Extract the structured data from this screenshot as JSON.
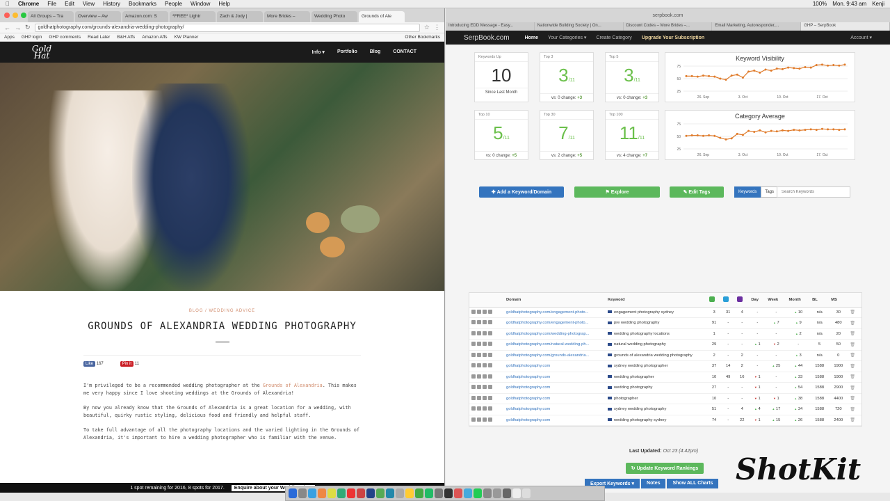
{
  "menubar": {
    "app": "Chrome",
    "items": [
      "File",
      "Edit",
      "View",
      "History",
      "Bookmarks",
      "People",
      "Window",
      "Help"
    ],
    "battery": "100%",
    "clock": "Mon. 9:43 am",
    "user": "Kenji"
  },
  "left": {
    "tabs": [
      "All Groups – Tra",
      "Overview – Aw",
      "Amazon.com: S",
      "*FREE* Lightr",
      "Zach & Jody |",
      "More Brides –",
      "Wedding Photo",
      "Grounds of Ale"
    ],
    "url": "goldhatphotography.com/grounds-alexandria-wedding-photography/",
    "bookmarks": [
      "Apps",
      "GHP login",
      "GHP comments",
      "Read Later",
      "B&H Affs",
      "Amazon Affs",
      "KW Planner",
      "Other Bookmarks"
    ],
    "site": {
      "logo": "Gold Hat",
      "nav": [
        "Info ▾",
        "Portfolio",
        "Blog",
        "CONTACT"
      ]
    },
    "crumbs": "BLOG  /  WEDDING ADVICE",
    "title": "GROUNDS OF ALEXANDRIA WEDDING PHOTOGRAPHY",
    "social": {
      "like": "Like",
      "likes": "167",
      "pin": "Pin it",
      "pins": "11"
    },
    "paragraphs": [
      {
        "pre": "I'm privileged to be a recommended wedding photographer at the ",
        "link": "Grounds of Alexandria",
        "post": ". This makes me very happy since I love shooting weddings at the Grounds of Alexandria!"
      },
      {
        "pre": "By now you already know that the Grounds of Alexandria is a great location for a wedding, with beautiful, quirky rustic styling, delicious food and friendly and helpful staff.",
        "link": "",
        "post": ""
      },
      {
        "pre": "To take full advantage of all the photography locations and the varied lighting in the Grounds of Alexandria, it's important to hire a wedding photographer who is familiar with the venue.",
        "link": "",
        "post": ""
      }
    ],
    "banner": {
      "text": "1 spot remaining for 2016, 8 spots for 2017.",
      "cta": "Enquire about your Wedding date"
    }
  },
  "right": {
    "toolbar_url": "serpbook.com",
    "tabs": [
      "Introducing EDD Message - Easy...",
      "Nationwide Building Society | On...",
      "Discount Codes – More Brides –...",
      "Email Marketing, Autoresponder,...",
      "GHP – SerpBook"
    ],
    "nav": {
      "brand": "SerpBook.com",
      "home": "Home",
      "categories": "Your Categories ▾",
      "create": "Create Category",
      "upgrade": "Upgrade Your Subscription",
      "account": "Account ▾"
    },
    "cards": [
      {
        "label": "Keywords Up",
        "value": "10",
        "sub": "Since Last Month",
        "green": false
      },
      {
        "label": "Top 3",
        "value": "3",
        "of": "/11",
        "sub": "vs: 0 change:",
        "change": "+3",
        "green": true
      },
      {
        "label": "Top 5",
        "value": "3",
        "of": "/11",
        "sub": "vs: 0 change:",
        "change": "+3",
        "green": true
      },
      {
        "label": "Top 10",
        "value": "5",
        "of": "/11",
        "sub": "vs: 0 change:",
        "change": "+5",
        "green": true
      },
      {
        "label": "Top 30",
        "value": "7",
        "of": "/11",
        "sub": "vs: 2 change:",
        "change": "+5",
        "green": true
      },
      {
        "label": "Top 100",
        "value": "11",
        "of": "/11",
        "sub": "vs: 4 change:",
        "change": "+7",
        "green": true
      }
    ],
    "charts": [
      {
        "title": "Keyword Visibility",
        "yticks": [
          "75",
          "50",
          "25"
        ],
        "xticks": [
          "26. Sep",
          "3. Oct",
          "10. Oct",
          "17. Oct"
        ],
        "color": "#e07b2a",
        "values": [
          55,
          55,
          54,
          56,
          55,
          54,
          50,
          48,
          56,
          58,
          52,
          64,
          66,
          62,
          68,
          66,
          70,
          69,
          72,
          71,
          70,
          73,
          72,
          77,
          78,
          76,
          77,
          76,
          78
        ]
      },
      {
        "title": "Category Average",
        "yticks": [
          "75",
          "50",
          "25"
        ],
        "xticks": [
          "26. Sep",
          "3. Oct",
          "10. Oct",
          "17. Oct"
        ],
        "color": "#e07b2a",
        "values": [
          51,
          52,
          52,
          51,
          52,
          51,
          47,
          44,
          46,
          55,
          53,
          61,
          59,
          62,
          58,
          61,
          60,
          62,
          61,
          63,
          62,
          63,
          64,
          63,
          65,
          64,
          64,
          63,
          64
        ]
      }
    ],
    "buttons": {
      "add": "Add a Keyword/Domain",
      "explore": "Explore",
      "edit": "Edit Tags",
      "seg": [
        "Keywords",
        "Tags"
      ],
      "search_placeholder": "Search Keywords"
    },
    "table": {
      "headers": [
        "",
        "Domain",
        "Keyword",
        "",
        "",
        "",
        "Day",
        "Week",
        "Month",
        "BL",
        "MS",
        ""
      ],
      "rows": [
        {
          "domain": "goldhatphotography.com/engagement-photo...",
          "keyword": "engagement photography sydney",
          "g": "3",
          "b": "31",
          "y": "4",
          "day": "-",
          "week": "-",
          "month": "10",
          "mdir": "up",
          "bl": "n/a",
          "ms": "30"
        },
        {
          "domain": "goldhatphotography.com/engagement-photo...",
          "keyword": "pre wedding photography",
          "g": "91",
          "b": "-",
          "y": "-",
          "day": "-",
          "dday": "",
          "week": "7",
          "wdir": "up",
          "wk2": "9",
          "w2dir": "up",
          "month": "9",
          "mdir": "up",
          "bl": "n/a",
          "ms": "480"
        },
        {
          "domain": "goldhatphotography.com/wedding-photograp...",
          "keyword": "wedding photography locations",
          "g": "1",
          "b": "-",
          "y": "-",
          "day": "-",
          "week": "-",
          "month": "2",
          "mdir": "up",
          "bl": "n/a",
          "ms": "20"
        },
        {
          "domain": "goldhatphotography.com/natural-wedding-ph...",
          "keyword": "natural wedding photography",
          "g": "29",
          "b": "-",
          "y": "-",
          "day": "1",
          "ddir": "up",
          "week": "2",
          "wdir": "dn",
          "month": "-",
          "bl": "5",
          "ms": "50"
        },
        {
          "domain": "goldhatphotography.com/grounds-alexandria...",
          "keyword": "grounds of alexandria wedding photography",
          "g": "2",
          "b": "-",
          "y": "2",
          "day": "-",
          "week": "-",
          "month": "3",
          "mdir": "up",
          "bl": "n/a",
          "ms": "0"
        },
        {
          "domain": "goldhatphotography.com",
          "keyword": "sydney wedding photographer",
          "g": "37",
          "b": "14",
          "y": "2",
          "day": "-",
          "week": "25",
          "wdir": "up",
          "month": "44",
          "mdir": "up",
          "bl": "1588",
          "ms": "1900"
        },
        {
          "domain": "goldhatphotography.com",
          "keyword": "wedding photographer",
          "g": "10",
          "b": "49",
          "y": "16",
          "day": "1",
          "ddir": "dn",
          "week": "-",
          "month": "33",
          "mdir": "up",
          "bl": "1588",
          "ms": "1900"
        },
        {
          "domain": "goldhatphotography.com",
          "keyword": "wedding photography",
          "g": "27",
          "b": "-",
          "y": "-",
          "day": "1",
          "ddir": "dn",
          "week": "-",
          "month": "54",
          "mdir": "up",
          "bl": "1588",
          "ms": "2900"
        },
        {
          "domain": "goldhatphotography.com",
          "keyword": "photographer",
          "g": "10",
          "b": "-",
          "y": "-",
          "day": "1",
          "ddir": "dn",
          "week": "1",
          "wdir": "dn",
          "month": "38",
          "mdir": "up",
          "bl": "1588",
          "ms": "4400"
        },
        {
          "domain": "goldhatphotography.com",
          "keyword": "sydney wedding photography",
          "g": "51",
          "b": "-",
          "y": "4",
          "day": "4",
          "ddir": "up",
          "week": "17",
          "wdir": "up",
          "month": "34",
          "mdir": "up",
          "bl": "1588",
          "ms": "720"
        },
        {
          "domain": "goldhatphotography.com",
          "keyword": "wedding photography sydney",
          "g": "74",
          "b": "-",
          "y": "22",
          "day": "1",
          "ddir": "dn",
          "week": "15",
          "wdir": "up",
          "month": "26",
          "mdir": "up",
          "bl": "1588",
          "ms": "2400"
        }
      ]
    },
    "updated_label": "Last Updated:",
    "updated_value": "Oct 23 (4:42pm)",
    "update_btn": "Update Keyword Rankings",
    "bottom": [
      "Export Keywords ▾",
      "Notes",
      "Show ALL Charts"
    ]
  },
  "watermark": "ShotKit"
}
